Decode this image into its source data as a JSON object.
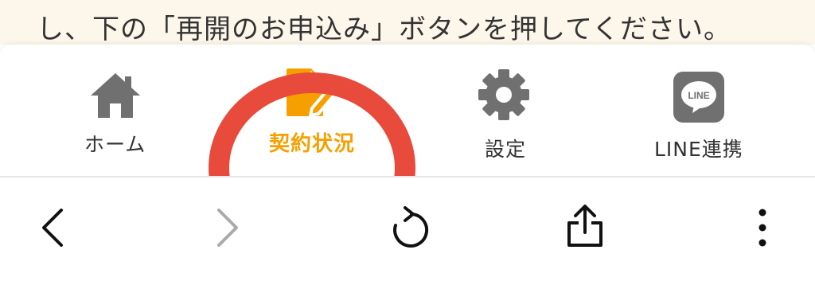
{
  "notice": {
    "text": "し、下の「再開のお申込み」ボタンを押してください。"
  },
  "tabs": [
    {
      "label": "ホーム",
      "icon": "home-icon",
      "active": false
    },
    {
      "label": "契約状況",
      "icon": "contract-document-icon",
      "active": true
    },
    {
      "label": "設定",
      "icon": "gear-icon",
      "active": false
    },
    {
      "label": "LINE連携",
      "icon": "line-icon",
      "active": false
    }
  ],
  "line_icon_text": "LINE",
  "browser_toolbar": {
    "back": "back-icon",
    "forward": "forward-icon",
    "reload": "reload-icon",
    "share": "share-icon",
    "more": "more-icon"
  },
  "colors": {
    "active": "#f5a000",
    "inactive_icon": "#707070",
    "label": "#333333",
    "highlight": "#e84a3c",
    "banner": "#fdf6ea"
  }
}
